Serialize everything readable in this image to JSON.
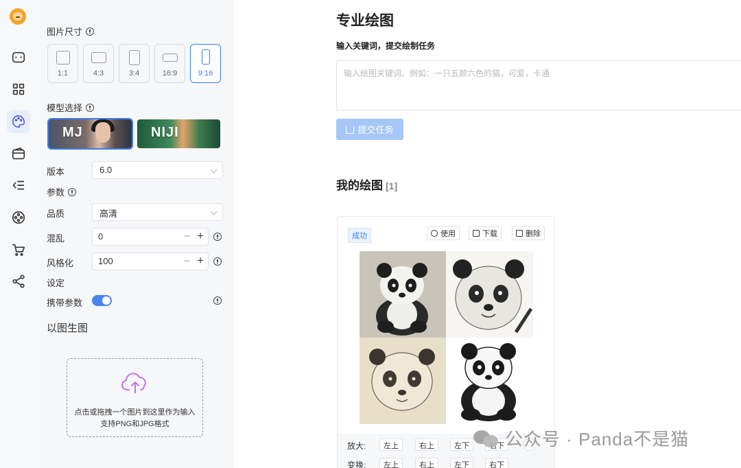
{
  "rail": {
    "items": [
      "chat-icon",
      "grid-icon",
      "palette-icon",
      "wallet-icon",
      "list-indent-icon",
      "film-reel-icon",
      "cart-icon",
      "share-icon"
    ],
    "active_index": 2
  },
  "panel": {
    "size_label": "图片尺寸",
    "ratios": [
      "1:1",
      "4:3",
      "3:4",
      "16:9",
      "9:16"
    ],
    "active_ratio": "9:16",
    "model_label": "模型选择",
    "models": [
      "MJ",
      "NIJI"
    ],
    "active_model": "MJ",
    "version_label": "版本",
    "version_value": "6.0",
    "params_label": "参数",
    "quality_label": "品质",
    "quality_value": "高清",
    "chaos_label": "混乱",
    "chaos_value": "0",
    "stylize_label": "风格化",
    "stylize_value": "100",
    "settings_label": "设定",
    "carry_params_label": "携带参数",
    "carry_params_on": true,
    "img2img_title": "以图生图",
    "upload_line1": "点击或拖拽一个图片到这里作为输入",
    "upload_line2": "支持PNG和JPG格式"
  },
  "main": {
    "title": "专业绘图",
    "prompt_label": "输入关键词，提交绘制任务",
    "prompt_placeholder": "输入绘图关键词。例如：一只五颜六色的猫，可爱，卡通",
    "submit_label": "提交任务",
    "my_title": "我的绘图",
    "my_count": "[1]"
  },
  "card": {
    "status": "成功",
    "use_label": "使用",
    "download_label": "下载",
    "delete_label": "删除",
    "upscale_label": "放大:",
    "variation_label": "变换:",
    "quadrants": [
      "左上",
      "右上",
      "左下",
      "右下"
    ]
  },
  "watermark": "公众号 · Panda不是猫"
}
